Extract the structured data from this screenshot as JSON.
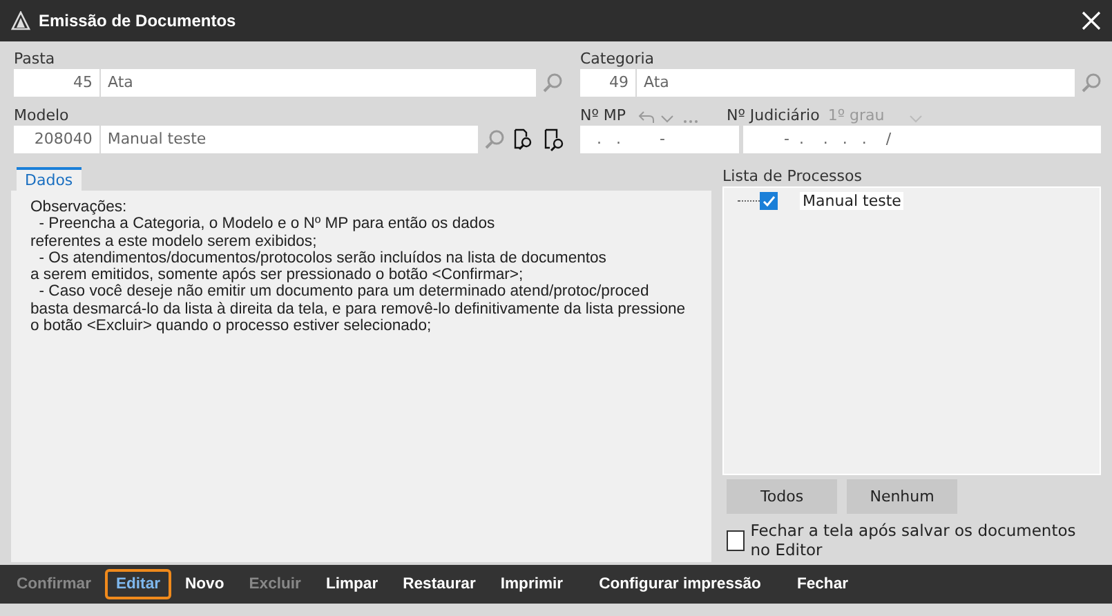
{
  "window": {
    "title": "Emissão de Documentos"
  },
  "pasta": {
    "label": "Pasta",
    "code": "45",
    "name": "Ata"
  },
  "categoria": {
    "label": "Categoria",
    "code": "49",
    "name": "Ata"
  },
  "modelo": {
    "label": "Modelo",
    "code": "208040",
    "name": "Manual teste"
  },
  "mp": {
    "label": "Nº MP",
    "value": "  .   .        -"
  },
  "judicial": {
    "label": "Nº Judiciário",
    "grade": "1º grau",
    "value": "       -  .    .   .   .    /"
  },
  "tabs": [
    {
      "label": "Dados",
      "selected": true
    }
  ],
  "observations": "Observações:\n  - Preencha a Categoria, o Modelo e o Nº MP para então os dados\nreferentes a este modelo serem exibidos;\n  - Os atendimentos/documentos/protocolos serão incluídos na lista de documentos\na serem emitidos, somente após ser pressionado o botão <Confirmar>;\n  - Caso você deseje não emitir um documento para um determinado atend/protoc/proced\nbasta desmarcá-lo da lista à direita da tela, e para removê-lo definitivamente da lista pressione\no botão <Excluir> quando o processo estiver selecionado;",
  "process_list": {
    "title": "Lista de Processos",
    "items": [
      {
        "label": "Manual teste",
        "checked": true
      }
    ]
  },
  "list_buttons": [
    "Todos",
    "Nenhum"
  ],
  "close_option": {
    "label": "Fechar a tela após salvar os documentos no Editor",
    "checked": false
  },
  "toolbar": [
    {
      "label": "Confirmar",
      "disabled": true,
      "selected": false
    },
    {
      "label": "Editar",
      "disabled": false,
      "selected": true
    },
    {
      "label": "Novo",
      "disabled": false,
      "selected": false
    },
    {
      "label": "Excluir",
      "disabled": true,
      "selected": false
    },
    {
      "label": "Limpar",
      "disabled": false,
      "selected": false
    },
    {
      "label": "Restaurar",
      "disabled": false,
      "selected": false
    },
    {
      "label": "Imprimir",
      "disabled": false,
      "selected": false
    },
    {
      "label": "Configurar impressão",
      "disabled": false,
      "selected": false
    },
    {
      "label": "Fechar",
      "disabled": false,
      "selected": false
    }
  ]
}
